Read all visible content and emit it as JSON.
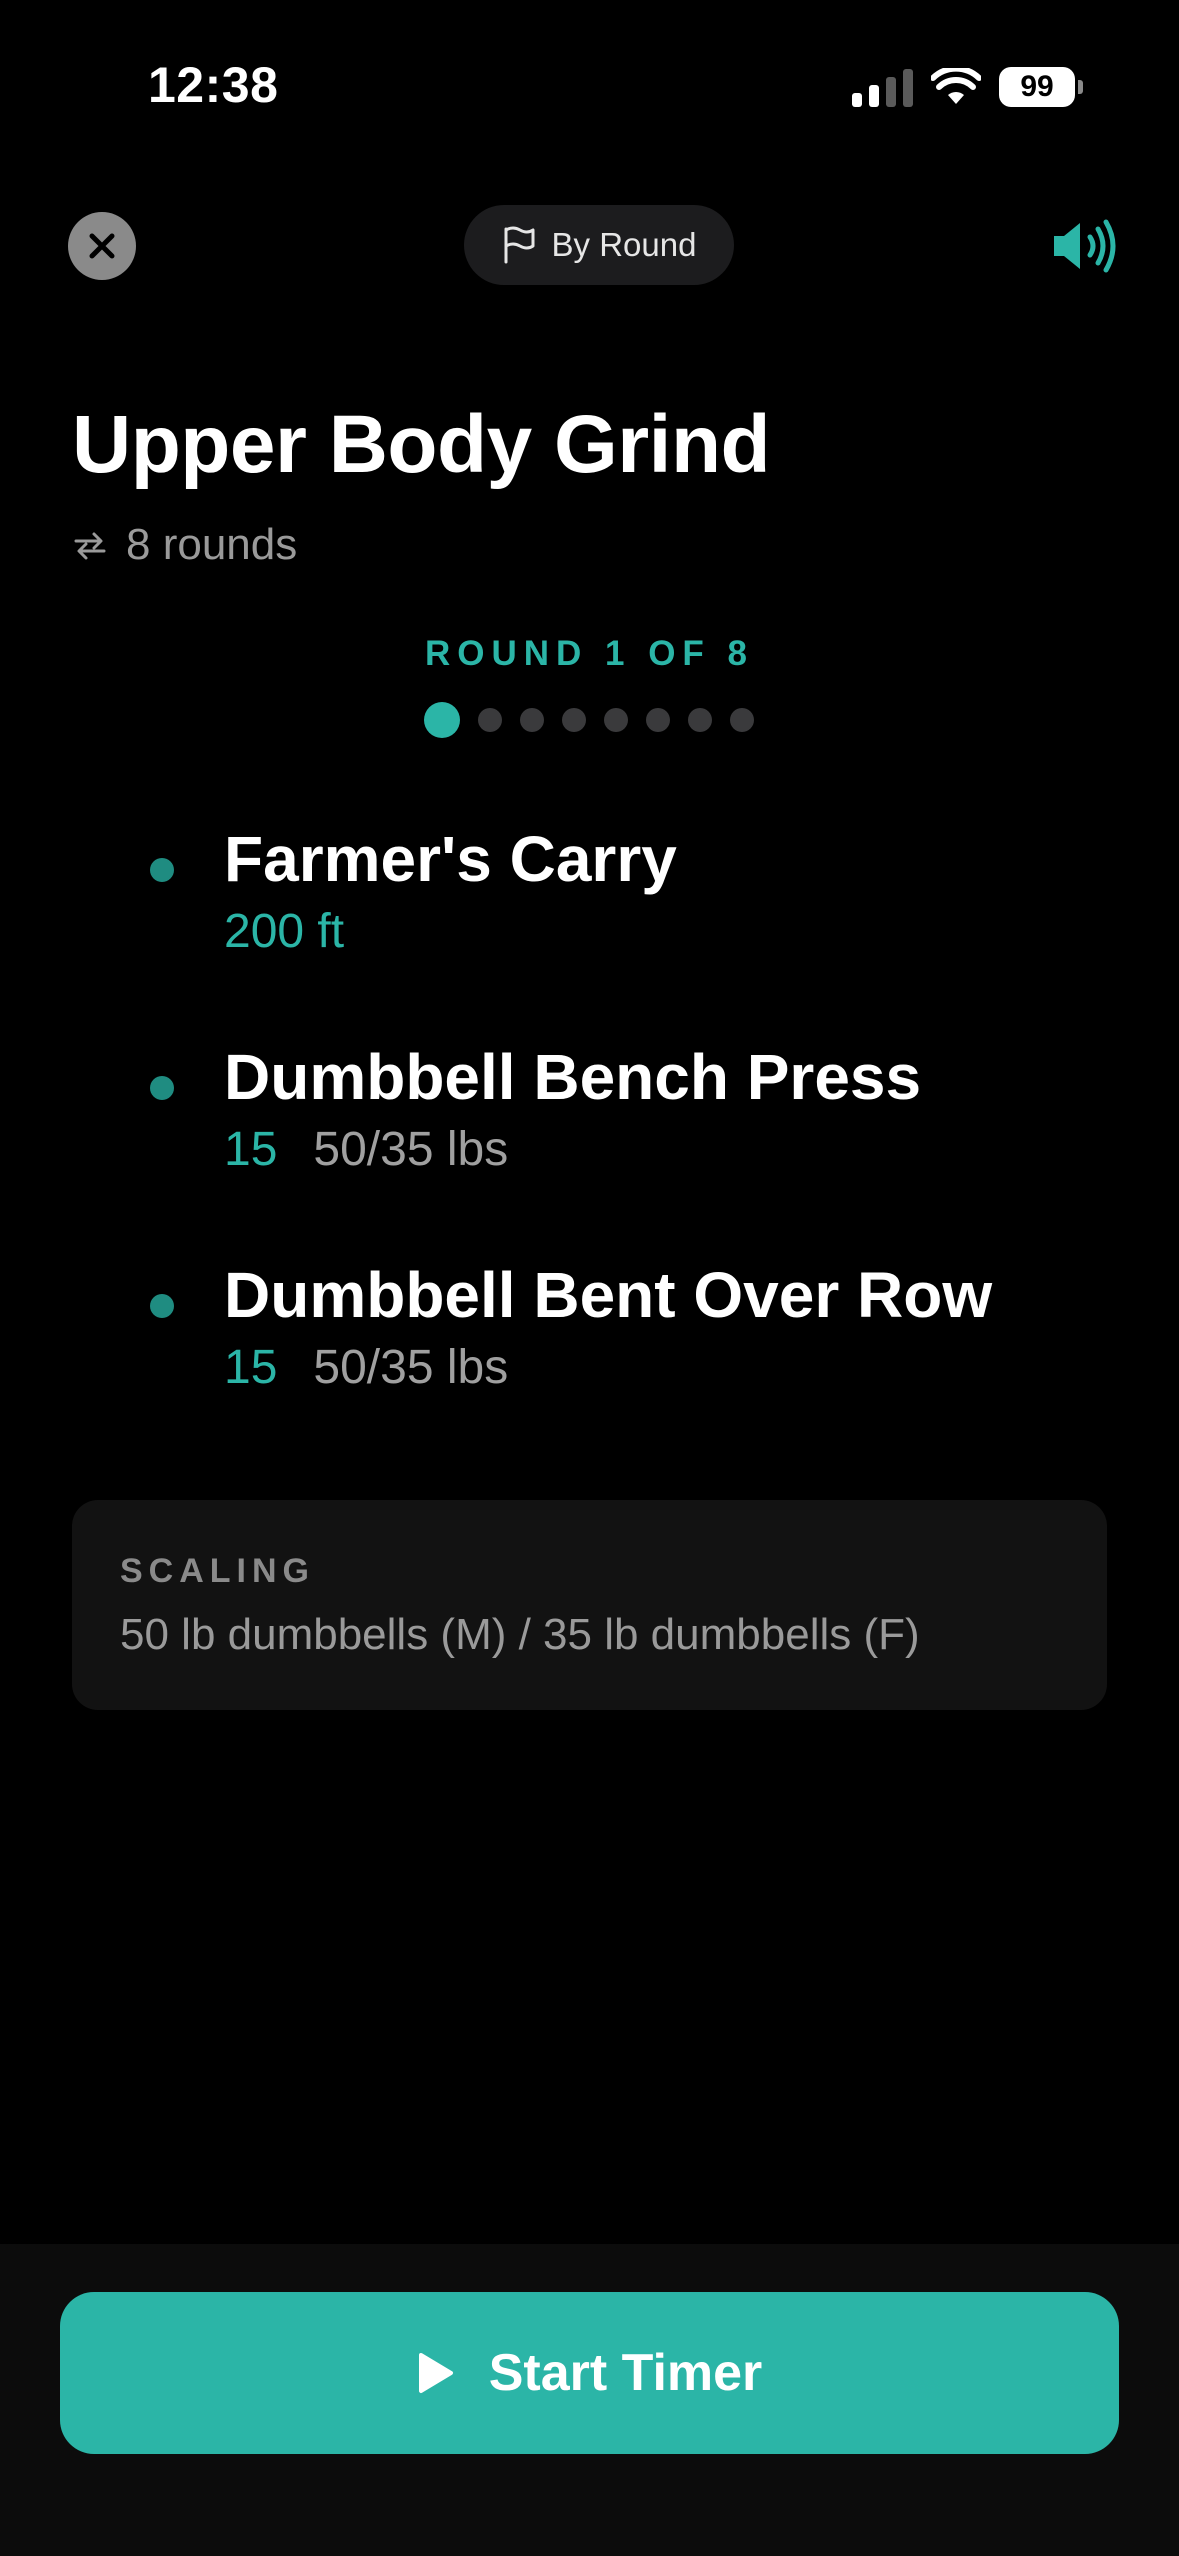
{
  "status_bar": {
    "time": "12:38",
    "battery": "99",
    "icons": [
      "cellular-signal-icon",
      "wifi-icon",
      "battery-icon"
    ]
  },
  "header": {
    "close_icon": "close-icon",
    "mode_label": "By Round",
    "mode_icon": "flag-icon",
    "sound_icon": "speaker-icon"
  },
  "workout": {
    "title": "Upper Body Grind",
    "rounds_icon": "repeat-icon",
    "rounds_text": "8 rounds"
  },
  "round_indicator": {
    "label": "ROUND 1 OF 8",
    "current": 1,
    "total": 8
  },
  "exercises": [
    {
      "name": "Farmer's Carry",
      "amount": "200 ft",
      "load": ""
    },
    {
      "name": "Dumbbell Bench Press",
      "amount": "15",
      "load": "50/35 lbs"
    },
    {
      "name": "Dumbbell Bent Over Row",
      "amount": "15",
      "load": "50/35 lbs"
    }
  ],
  "scaling": {
    "label": "SCALING",
    "text": "50 lb dumbbells (M) / 35 lb dumbbells (F)"
  },
  "start_button": {
    "label": "Start Timer",
    "icon": "play-icon"
  },
  "colors": {
    "accent": "#2bb5a7",
    "background": "#000000",
    "card": "#121212",
    "muted_text": "#9a9a9a"
  }
}
